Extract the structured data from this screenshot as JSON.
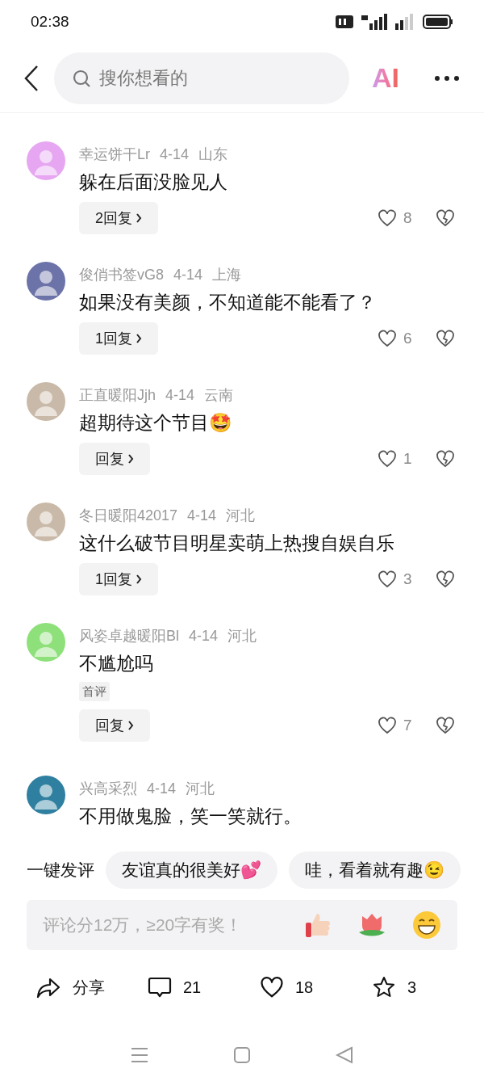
{
  "status_bar": {
    "time": "02:38"
  },
  "header": {
    "search_placeholder": "搜你想看的",
    "ai_label": "AI"
  },
  "comments": [
    {
      "user": "幸运饼干Lr",
      "date": "4-14",
      "location": "山东",
      "text": "躲在后面没脸见人",
      "reply": "2回复",
      "likes": "8",
      "color": "#e7a6f2"
    },
    {
      "user": "俊俏书签vG8",
      "date": "4-14",
      "location": "上海",
      "text": "如果没有美颜，不知道能不能看了？",
      "reply": "1回复",
      "likes": "6",
      "color": "#6b73a8"
    },
    {
      "user": "正直暖阳Jjh",
      "date": "4-14",
      "location": "云南",
      "text": "超期待这个节目🤩",
      "reply": "回复",
      "likes": "1",
      "color": "#c9b9a8"
    },
    {
      "user": "冬日暖阳42017",
      "date": "4-14",
      "location": "河北",
      "text": "这什么破节目明星卖萌上热搜自娱自乐",
      "reply": "1回复",
      "likes": "3",
      "color": "#c9b9a8"
    },
    {
      "user": "风姿卓越暖阳Bl",
      "date": "4-14",
      "location": "河北",
      "text": "不尴尬吗",
      "reply": "回复",
      "likes": "7",
      "color": "#8ee07a",
      "badge": "首评"
    },
    {
      "user": "兴高采烈",
      "date": "4-14",
      "location": "河北",
      "text": "不用做鬼脸，笑一笑就行。",
      "color": "#2f7fa0"
    }
  ],
  "quick_comment": {
    "label": "一键发评",
    "chips": [
      "友谊真的很美好💕",
      "哇，看着就有趣😉"
    ]
  },
  "comment_input": {
    "placeholder": "评论分12万，≥20字有奖！"
  },
  "action_bar": [
    {
      "kind": "share",
      "label": "分享"
    },
    {
      "kind": "comment",
      "label": "21"
    },
    {
      "kind": "like",
      "label": "18"
    },
    {
      "kind": "star",
      "label": "3"
    }
  ]
}
